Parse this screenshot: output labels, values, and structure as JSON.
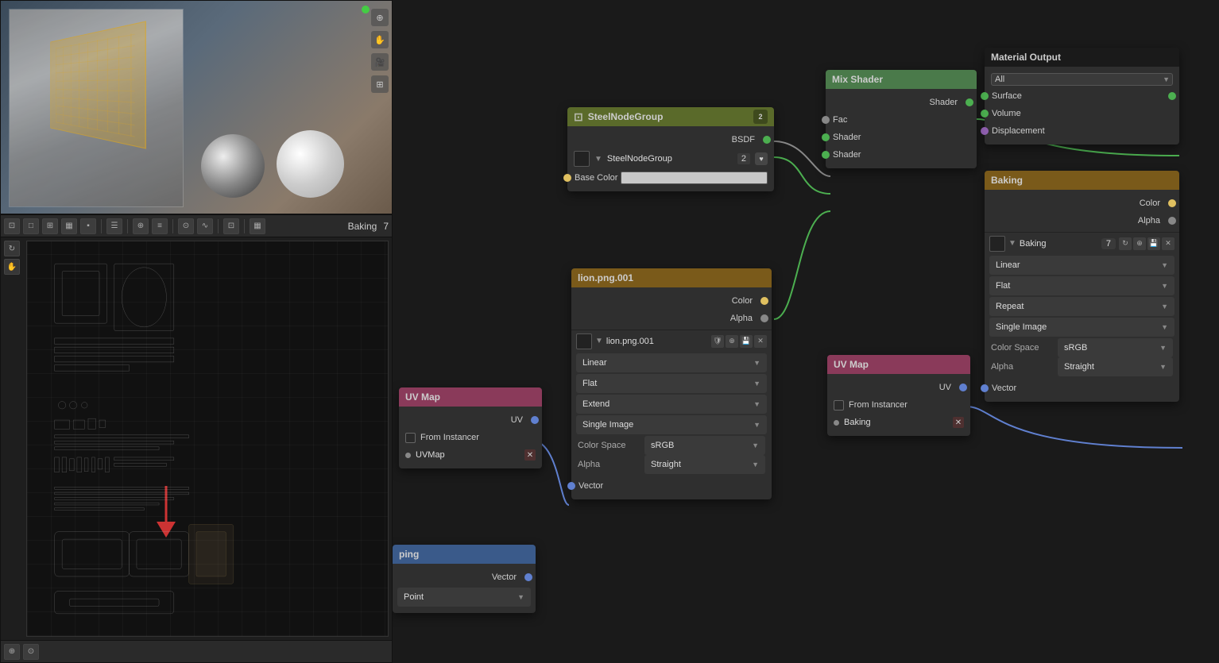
{
  "viewport": {
    "toolbar": {
      "mode_btn": "⊞",
      "baking_label": "Baking",
      "baking_num": "7"
    }
  },
  "nodes": {
    "material_output": {
      "title": "Material Output",
      "dropdown": "All",
      "sockets": {
        "surface": "Surface",
        "volume": "Volume",
        "displacement": "Displacement"
      }
    },
    "mix_shader": {
      "title": "Mix Shader",
      "sockets": {
        "fac": "Fac",
        "shader1": "Shader",
        "shader2": "Shader",
        "out_shader": "Shader"
      }
    },
    "steel_node_group": {
      "title": "SteelNodeGroup",
      "badge": "2",
      "dropdown": "SteelNodeGroup",
      "count": "2",
      "sockets": {
        "bsdf": "BSDF",
        "base_color": "Base Color"
      }
    },
    "baking": {
      "title": "Baking",
      "img_name": "Baking",
      "img_num": "7",
      "dropdowns": {
        "interp": "Linear",
        "proj": "Flat",
        "ext": "Repeat",
        "src": "Single Image",
        "color_space_label": "Color Space",
        "color_space_val": "sRGB",
        "alpha_label": "Alpha",
        "alpha_val": "Straight"
      },
      "sockets": {
        "color": "Color",
        "alpha": "Alpha",
        "vector": "Vector"
      }
    },
    "lion_png": {
      "title": "lion.png.001",
      "img_name": "lion.png.001",
      "dropdowns": {
        "interp": "Linear",
        "proj": "Flat",
        "ext": "Extend",
        "src": "Single Image",
        "color_space_label": "Color Space",
        "color_space_val": "sRGB",
        "alpha_label": "Alpha",
        "alpha_val": "Straight"
      },
      "sockets": {
        "color": "Color",
        "alpha": "Alpha",
        "vector": "Vector"
      }
    },
    "uvmap_left": {
      "title": "UV Map",
      "from_instancer": "From Instancer",
      "uv_name": "UVMap",
      "sockets": {
        "uv": "UV"
      }
    },
    "uvmap_right": {
      "title": "UV Map",
      "from_instancer": "From Instancer",
      "uv_name": "Baking",
      "sockets": {
        "uv": "UV"
      }
    },
    "bottom_partial": {
      "title": "ping",
      "socket": "Vector",
      "dropdown": "Point"
    }
  },
  "colors": {
    "socket_green": "#4caf50",
    "socket_yellow": "#c8a830",
    "socket_gray": "#888888",
    "socket_blue": "#6080d0",
    "socket_purple": "#9060b0",
    "header_green": "#4a7a4a",
    "header_olive": "#5a6a2a",
    "header_brown": "#7a5a1a",
    "header_pink": "#8a3a5a",
    "header_gray": "#555555",
    "header_blue": "#3a5a8a"
  }
}
